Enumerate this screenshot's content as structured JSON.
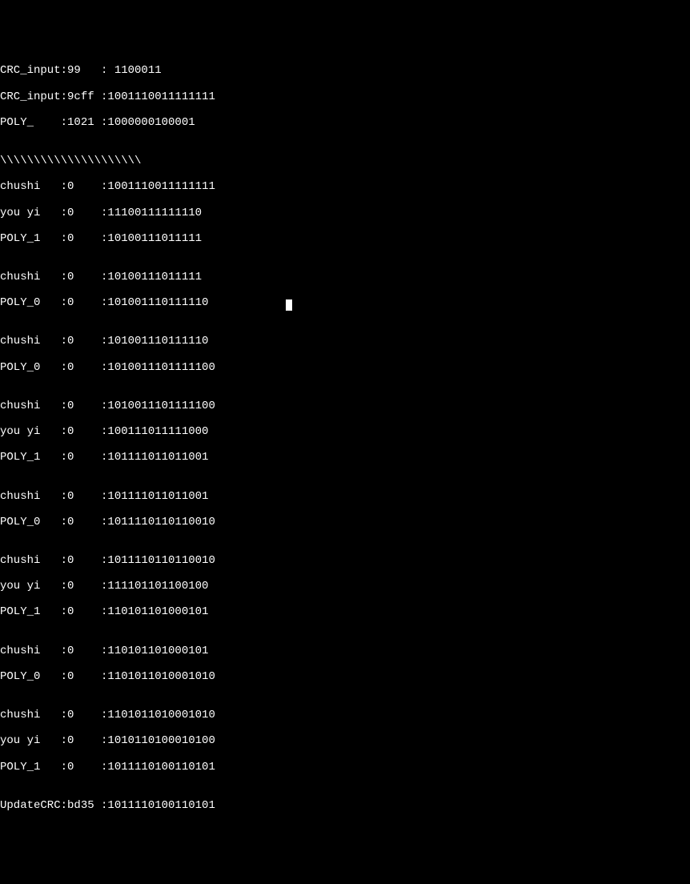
{
  "terminal": {
    "lines": [
      "CRC_input:99   : 1100011",
      "CRC_input:9cff :1001110011111111",
      "POLY_    :1021 :1000000100001",
      "",
      "\\\\\\\\\\\\\\\\\\\\\\\\\\\\\\\\\\\\\\\\\\",
      "chushi   :0    :1001110011111111",
      "you yi   :0    :11100111111110",
      "POLY_1   :0    :10100111011111",
      "",
      "chushi   :0    :10100111011111",
      "POLY_0   :0    :101001110111110",
      "",
      "chushi   :0    :101001110111110",
      "POLY_0   :0    :1010011101111100",
      "",
      "chushi   :0    :1010011101111100",
      "you yi   :0    :100111011111000",
      "POLY_1   :0    :101111011011001",
      "",
      "chushi   :0    :101111011011001",
      "POLY_0   :0    :1011110110110010",
      "",
      "chushi   :0    :1011110110110010",
      "you yi   :0    :111101101100100",
      "POLY_1   :0    :110101101000101",
      "",
      "chushi   :0    :110101101000101",
      "POLY_0   :0    :1101011010001010",
      "",
      "chushi   :0    :1101011010001010",
      "you yi   :0    :1010110100010100",
      "POLY_1   :0    :1011110100110101",
      "",
      "UpdateCRC:bd35 :1011110100110101"
    ]
  }
}
